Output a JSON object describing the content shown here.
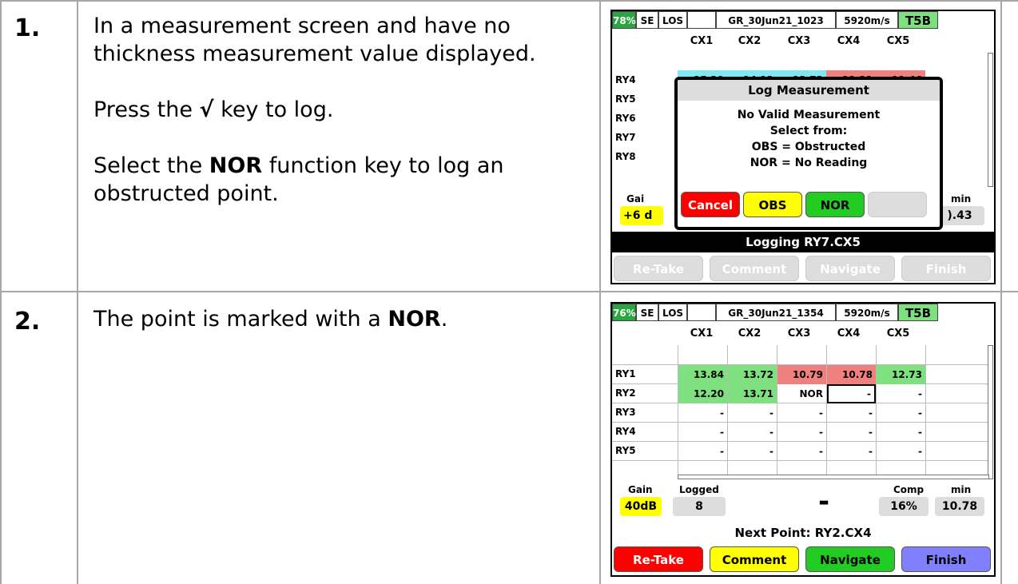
{
  "steps": [
    {
      "number": "1.",
      "p1": "In a measurement screen and have no thickness measurement value displayed.",
      "p2_pre": "Press the ",
      "p2_key": "√",
      "p2_post": " key to log.",
      "p3_pre": "Select the ",
      "p3_bold": "NOR",
      "p3_post": " function key to log an obstructed point."
    },
    {
      "number": "2.",
      "p1_pre": "The point is marked with a ",
      "p1_bold": "NOR",
      "p1_post": "."
    }
  ],
  "screen1": {
    "battery": "78%",
    "mode": "SE",
    "los": "LOS",
    "file": "GR_30Jun21_1023",
    "velocity": "5920m/s",
    "probe": "T5B",
    "columns": [
      "CX1",
      "CX2",
      "CX3",
      "CX4",
      "CX5"
    ],
    "rows": [
      "RY4",
      "RY5",
      "RY6",
      "RY7",
      "RY8"
    ],
    "row_ry4": [
      "15.29",
      "14.12",
      "12.73",
      "11.31",
      "11.46"
    ],
    "gain_label": "Gai",
    "gain_value": "+6 d",
    "min_label": "min",
    "min_value": ").43",
    "dialog": {
      "title": "Log Measurement",
      "line1": "No Valid Measurement",
      "line2": "Select from:",
      "line3": "OBS = Obstructed",
      "line4": "NOR = No Reading",
      "btn_cancel": "Cancel",
      "btn_obs": "OBS",
      "btn_nor": "NOR",
      "btn_blank": ""
    },
    "status": "Logging RY7.CX5",
    "bottom_buttons": [
      "Re-Take",
      "Comment",
      "Navigate",
      "Finish"
    ]
  },
  "screen2": {
    "battery": "76%",
    "mode": "SE",
    "los": "LOS",
    "file": "GR_30Jun21_1354",
    "velocity": "5920m/s",
    "probe": "T5B",
    "columns": [
      "CX1",
      "CX2",
      "CX3",
      "CX4",
      "CX5"
    ],
    "rows": [
      "RY1",
      "RY2",
      "RY3",
      "RY4",
      "RY5"
    ],
    "cells": [
      [
        "13.84",
        "13.72",
        "10.79",
        "10.78",
        "12.73"
      ],
      [
        "12.20",
        "13.71",
        "NOR",
        "-",
        "-"
      ],
      [
        "-",
        "-",
        "-",
        "-",
        "-"
      ],
      [
        "-",
        "-",
        "-",
        "-",
        "-"
      ],
      [
        "-",
        "-",
        "-",
        "-",
        "-"
      ]
    ],
    "gain_label": "Gain",
    "gain_value": "40dB",
    "logged_label": "Logged",
    "logged_value": "8",
    "reading": "-",
    "comp_label": "Comp",
    "comp_value": "16%",
    "min_label": "min",
    "min_value": "10.78",
    "status": "Next Point: RY2.CX4",
    "bottom_buttons": [
      "Re-Take",
      "Comment",
      "Navigate",
      "Finish"
    ]
  },
  "colors": {
    "green": "#7fe07f",
    "red": "#f08080",
    "cyan": "#7fe8f0",
    "yellow": "#ffff00",
    "btn_red": "#ff0000",
    "btn_green": "#22cc22",
    "btn_purple": "#8080ff"
  }
}
